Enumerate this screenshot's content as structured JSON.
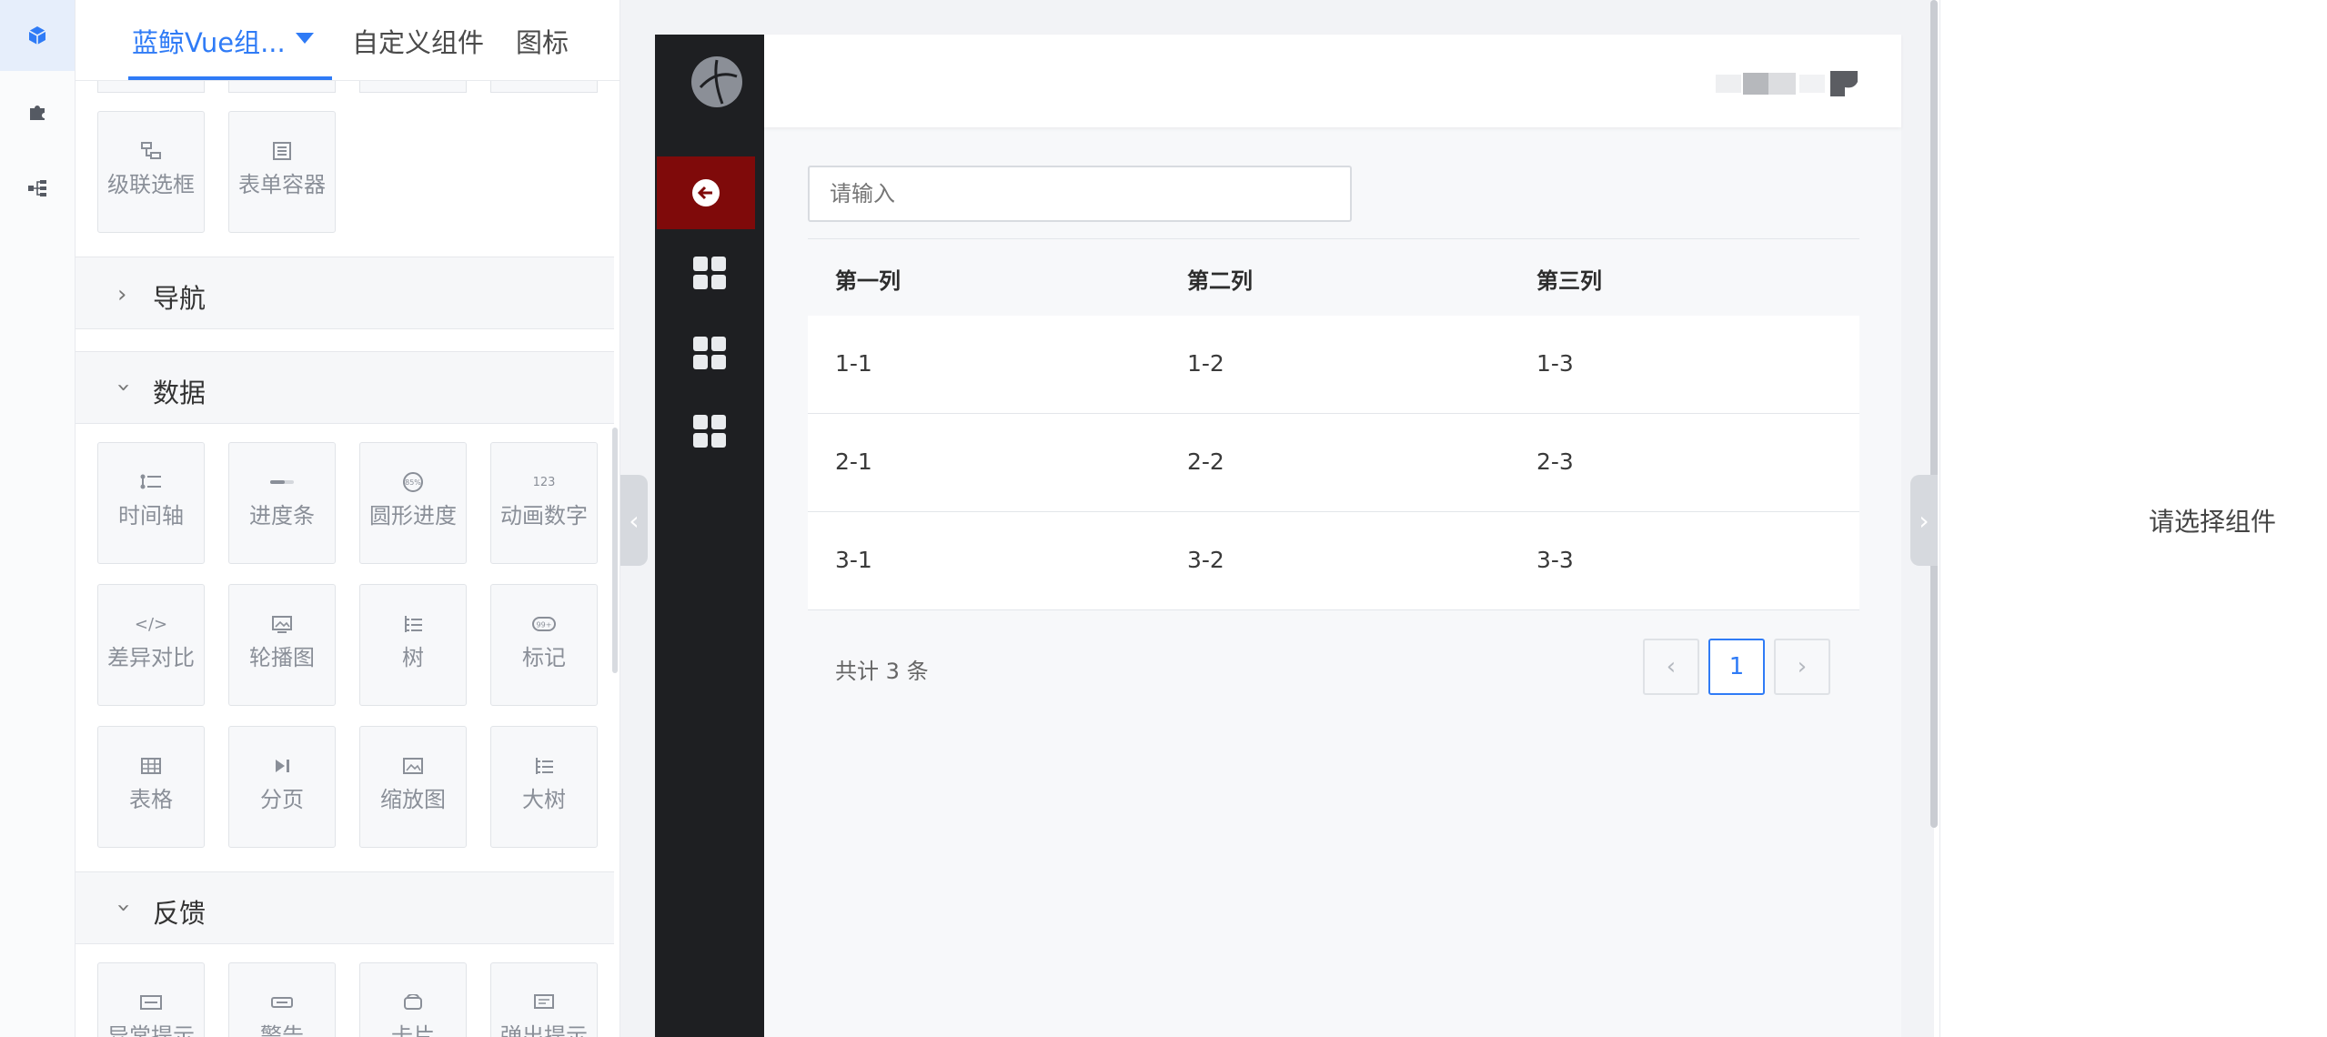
{
  "rail": {
    "items": [
      {
        "icon": "cube-icon",
        "active": true
      },
      {
        "icon": "puzzle-icon",
        "active": false
      },
      {
        "icon": "tree-structure-icon",
        "active": false
      }
    ]
  },
  "panel": {
    "tabs": [
      {
        "label": "蓝鲸Vue组...",
        "active": true
      },
      {
        "label": "自定义组件",
        "active": false
      },
      {
        "label": "图标",
        "active": false
      }
    ],
    "form_cards": [
      {
        "label": "级联选框",
        "icon": "cascader-icon"
      },
      {
        "label": "表单容器",
        "icon": "form-container-icon"
      }
    ],
    "sections": {
      "nav": {
        "label": "导航",
        "expanded": false
      },
      "data": {
        "label": "数据",
        "expanded": true
      },
      "feedback": {
        "label": "反馈",
        "expanded": true
      }
    },
    "data_cards": [
      {
        "label": "时间轴",
        "icon": "timeline-icon"
      },
      {
        "label": "进度条",
        "icon": "progress-bar-icon"
      },
      {
        "label": "圆形进度",
        "icon": "circle-progress-icon",
        "glyph": "85%"
      },
      {
        "label": "动画数字",
        "icon": "animated-number-icon",
        "glyph": "123"
      },
      {
        "label": "差异对比",
        "icon": "diff-code-icon",
        "glyph": "</>"
      },
      {
        "label": "轮播图",
        "icon": "carousel-image-icon"
      },
      {
        "label": "树",
        "icon": "tree-icon"
      },
      {
        "label": "标记",
        "icon": "badge-icon",
        "glyph": "99+"
      },
      {
        "label": "表格",
        "icon": "table-icon"
      },
      {
        "label": "分页",
        "icon": "pagination-icon"
      },
      {
        "label": "缩放图",
        "icon": "zoom-image-icon"
      },
      {
        "label": "大树",
        "icon": "big-tree-icon"
      }
    ],
    "feedback_cards": [
      {
        "label": "异常提示",
        "icon": "exception-icon"
      },
      {
        "label": "警告",
        "icon": "alert-icon"
      },
      {
        "label": "卡片",
        "icon": "card-icon"
      },
      {
        "label": "弹出提示",
        "icon": "popover-icon"
      }
    ]
  },
  "app": {
    "search_placeholder": "请输入",
    "table": {
      "columns": [
        "第一列",
        "第二列",
        "第三列"
      ],
      "rows": [
        [
          "1-1",
          "1-2",
          "1-3"
        ],
        [
          "2-1",
          "2-2",
          "2-3"
        ],
        [
          "3-1",
          "3-2",
          "3-3"
        ]
      ]
    },
    "pagination": {
      "total_prefix": "共计",
      "total_count": "3",
      "total_suffix": "条",
      "current_page": "1"
    },
    "colors": {
      "sidebar": "#1e1f22",
      "active_menu": "#7f0a0a",
      "accent": "#2f7bf6"
    }
  },
  "props": {
    "empty_text": "请选择组件"
  }
}
